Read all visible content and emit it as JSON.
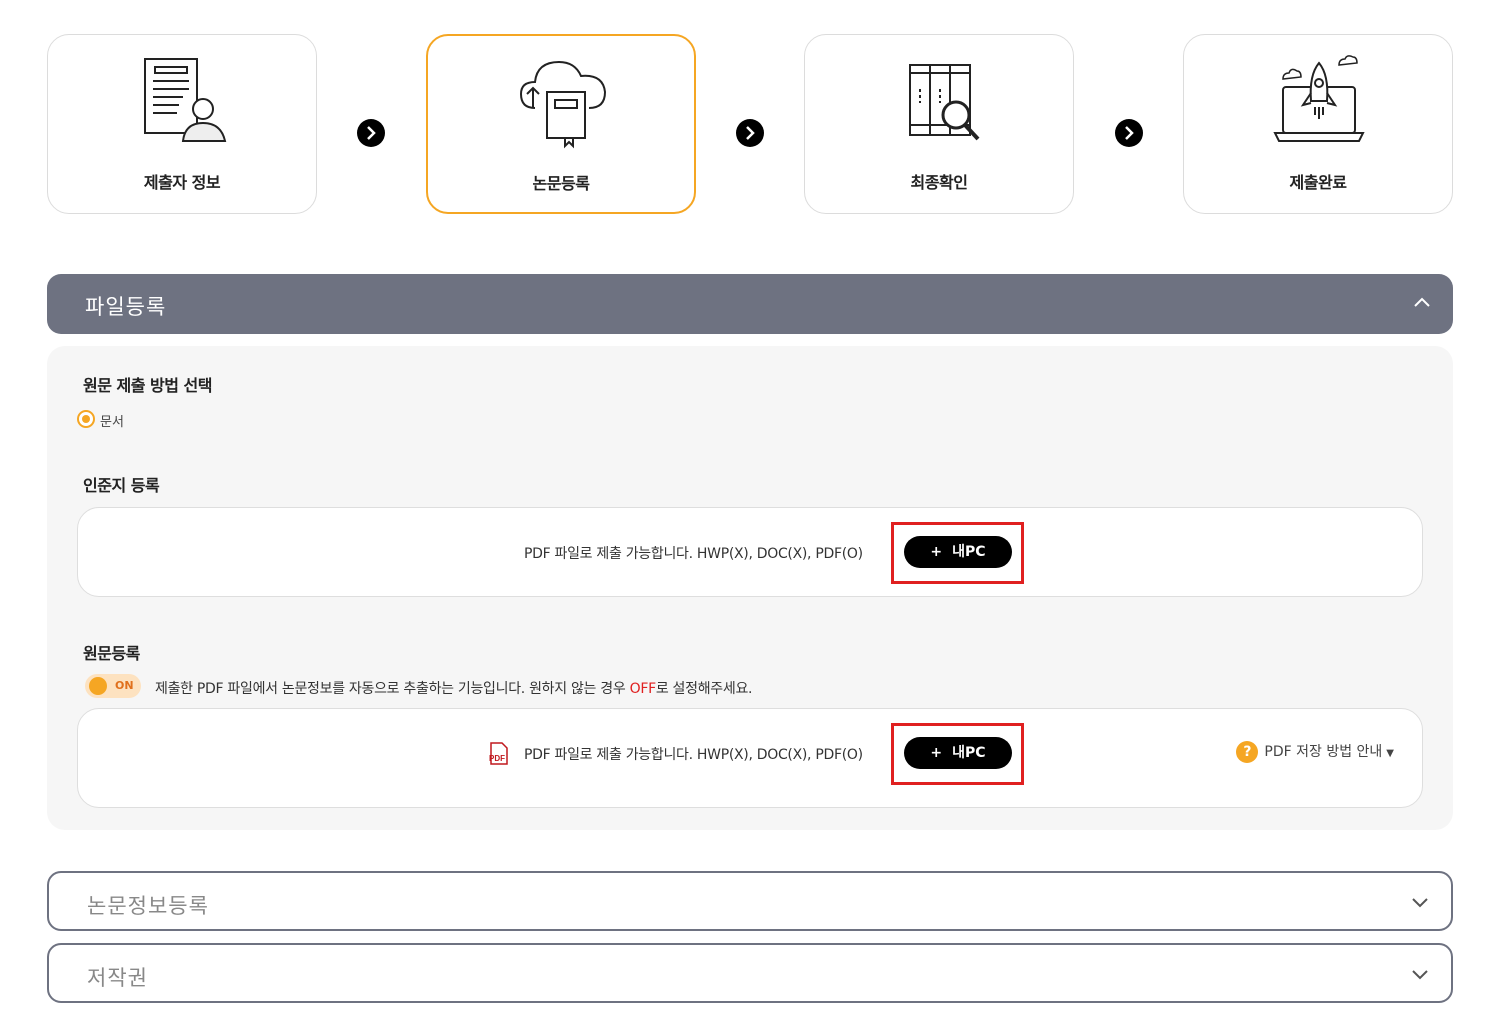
{
  "steps": [
    {
      "label": "제출자 정보",
      "icon": "document-person-icon",
      "active": false
    },
    {
      "label": "논문등록",
      "icon": "cloud-upload-book-icon",
      "active": true
    },
    {
      "label": "최종확인",
      "icon": "books-magnifier-icon",
      "active": false
    },
    {
      "label": "제출완료",
      "icon": "laptop-rocket-icon",
      "active": false
    }
  ],
  "accordions": {
    "file": {
      "title": "파일등록",
      "state": "expanded"
    },
    "info": {
      "title": "논문정보등록",
      "state": "collapsed"
    },
    "copyright": {
      "title": "저작권",
      "state": "collapsed"
    }
  },
  "file_panel": {
    "method_heading": "원문 제출 방법 선택",
    "method_option": "문서",
    "approval_heading": "인준지 등록",
    "approval_note": "PDF 파일로 제출 가능합니다. HWP(X), DOC(X), PDF(O)",
    "mypc_label": "내PC",
    "mypc_plus": "+",
    "original_heading": "원문등록",
    "toggle_label": "ON",
    "toggle_desc_before": "제출한 PDF 파일에서 논문정보를 자동으로 추출하는 기능입니다. 원하지 않는 경우 ",
    "toggle_desc_highlight": "OFF",
    "toggle_desc_after": "로 설정해주세요.",
    "original_note": "PDF 파일로 제출 가능합니다. HWP(X), DOC(X), PDF(O)",
    "pdf_icon_text": "PDF",
    "guide_label": "PDF 저장 방법 안내",
    "guide_q": "?"
  },
  "colors": {
    "accent": "#f5a623",
    "header_bg": "#6e7281",
    "highlight_red": "#e02020"
  }
}
